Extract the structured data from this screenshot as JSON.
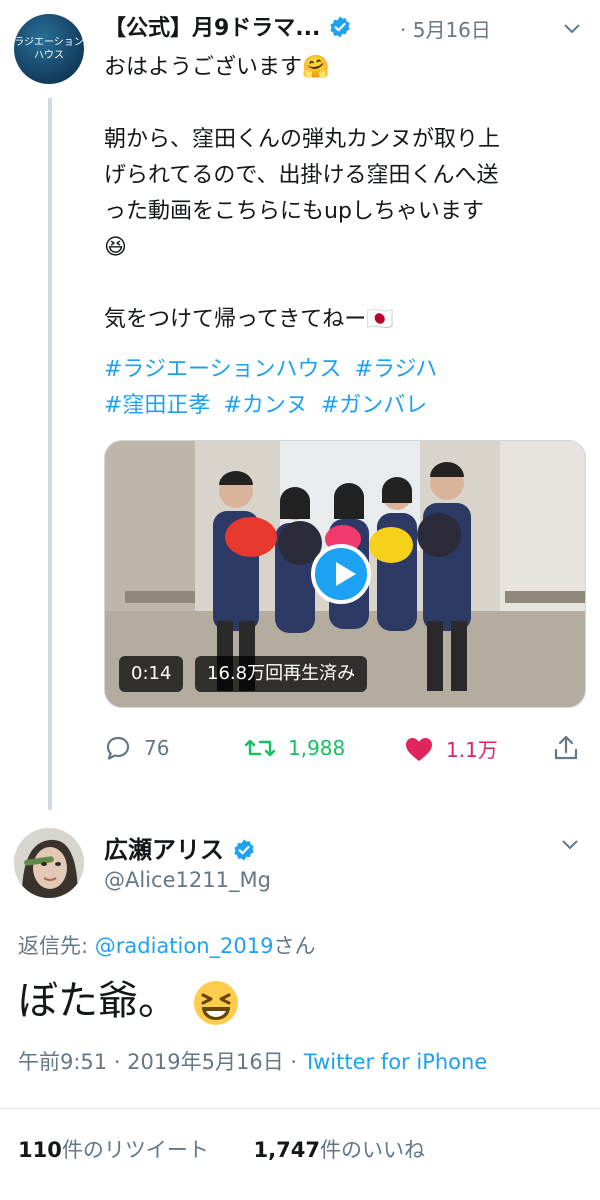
{
  "parent_tweet": {
    "avatar_lines": [
      "ラジエーション",
      "ハウス"
    ],
    "display_name": "【公式】月9ドラマ...",
    "date": "· 5月16日",
    "text_lines": [
      "おはようございます🤗",
      "",
      "朝から、窪田くんの弾丸カンヌが取り上",
      "げられてるので、出掛ける窪田くんへ送",
      "った動画をこちらにもupしちゃいます",
      "😆",
      "",
      "気をつけて帰ってきてねー🇯🇵"
    ],
    "hashtags": [
      "#ラジエーションハウス",
      "#ラジハ",
      "#窪田正孝",
      "#カンヌ",
      "#ガンバレ"
    ],
    "video": {
      "duration": "0:14",
      "views": "16.8万回再生済み"
    },
    "actions": {
      "replies": "76",
      "retweets": "1,988",
      "likes": "1.1万"
    },
    "colors": {
      "retweet": "#17bf63",
      "like": "#e0245e",
      "link": "#1da1f2"
    }
  },
  "reply_tweet": {
    "display_name": "広瀬アリス",
    "handle": "@Alice1211_Mg",
    "replying_prefix": "返信先: ",
    "replying_mention": "@radiation_2019",
    "replying_suffix": "さん",
    "text": "ぼた爺。",
    "time": "午前9:51 · 2019年5月16日 · ",
    "source": "Twitter for iPhone",
    "retweet_count": "110",
    "retweet_label": "件のリツイート",
    "like_count": "1,747",
    "like_label": "件のいいね"
  }
}
